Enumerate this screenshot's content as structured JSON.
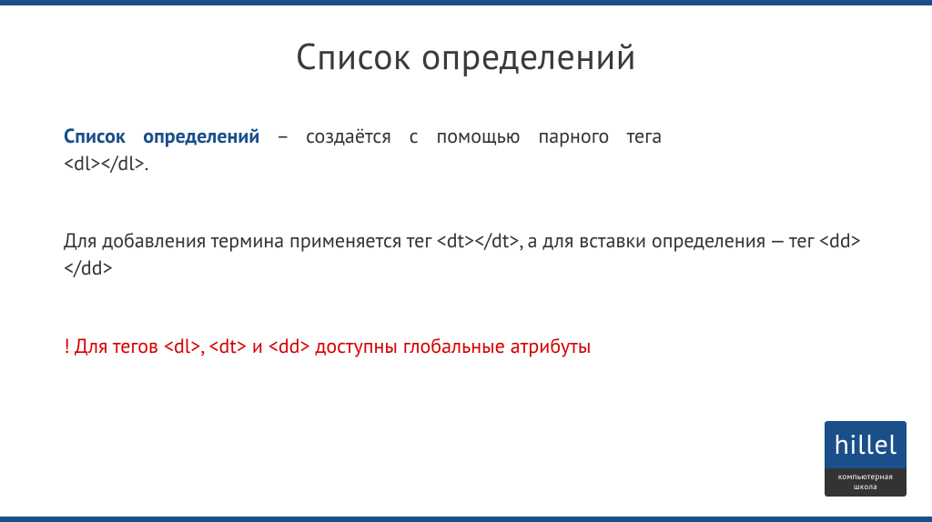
{
  "title": "Список определений",
  "para1": {
    "term": "Список определений",
    "rest_line1": " – создаётся с помощью парного тега",
    "line2": "<dl></dl>."
  },
  "para2": "Для добавления термина применяется тег <dt></dt>, а для вставки определения — тег <dd></dd>",
  "para3": "! Для тегов <dl>, <dt> и <dd> доступны глобальные атрибуты",
  "logo": {
    "name": "hillel",
    "tagline_line1": "компьютерная",
    "tagline_line2": "школа"
  }
}
